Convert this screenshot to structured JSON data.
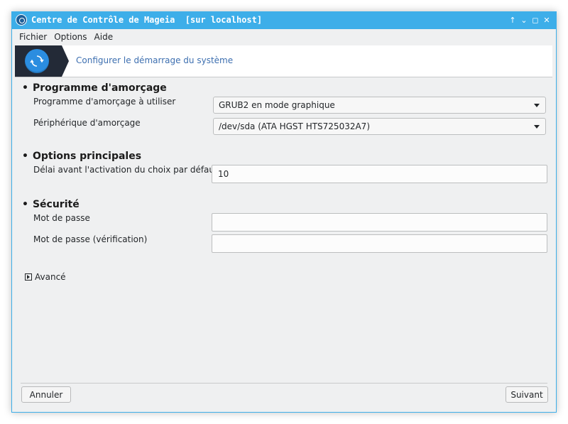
{
  "window": {
    "title": "Centre de Contrôle de Mageia  [sur localhost]",
    "controls": {
      "keep_above": "↑",
      "minimize": "⌄",
      "maximize": "◻",
      "close": "✕"
    }
  },
  "menubar": {
    "items": [
      "Fichier",
      "Options",
      "Aide"
    ]
  },
  "banner": {
    "title": "Configurer le démarrage du système",
    "icon": "refresh-icon"
  },
  "sections": {
    "bootloader": {
      "title": "Programme d'amorçage",
      "program_label": "Programme d'amorçage à utiliser",
      "program_value": "GRUB2 en mode graphique",
      "device_label": "Périphérique d'amorçage",
      "device_value": "/dev/sda (ATA HGST HTS725032A7)"
    },
    "main_options": {
      "title": "Options principales",
      "delay_label": "Délai avant l'activation du choix par défaut",
      "delay_value": "10"
    },
    "security": {
      "title": "Sécurité",
      "password_label": "Mot de passe",
      "password_value": "",
      "password_confirm_label": "Mot de passe (vérification)",
      "password_confirm_value": ""
    }
  },
  "advanced": {
    "label": "Avancé"
  },
  "buttons": {
    "cancel": "Annuler",
    "next": "Suivant"
  },
  "colors": {
    "titlebar": "#3daee9",
    "banner_icon_bg": "#232a37",
    "banner_circle": "#2b8de0",
    "banner_text": "#3d6fb0",
    "window_bg": "#eff0f1"
  }
}
